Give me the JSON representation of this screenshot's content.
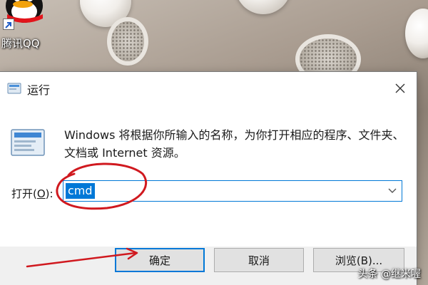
{
  "desktop": {
    "shortcut_label": "腾讯QQ",
    "watermark": "头条 @继米喔"
  },
  "dialog": {
    "title": "运行",
    "description": "Windows 将根据你所输入的名称，为你打开相应的程序、文件夹、文档或 Internet 资源。",
    "open_label_prefix": "打开(",
    "open_label_key": "O",
    "open_label_suffix": "):",
    "command_value": "cmd",
    "buttons": {
      "ok": "确定",
      "cancel": "取消",
      "browse": "浏览(B)..."
    }
  },
  "annotations": {
    "circle_color": "#d0191f",
    "arrow_color": "#d0191f"
  },
  "colors": {
    "accent": "#0078d7",
    "dialog_bg": "#f0f0f0",
    "content_bg": "#ffffff"
  },
  "icons": {
    "title": "run-dialog-icon",
    "close": "close-icon",
    "content": "run-dialog-icon",
    "combo": "chevron-down-icon",
    "desktop": "qq-penguin-icon"
  }
}
